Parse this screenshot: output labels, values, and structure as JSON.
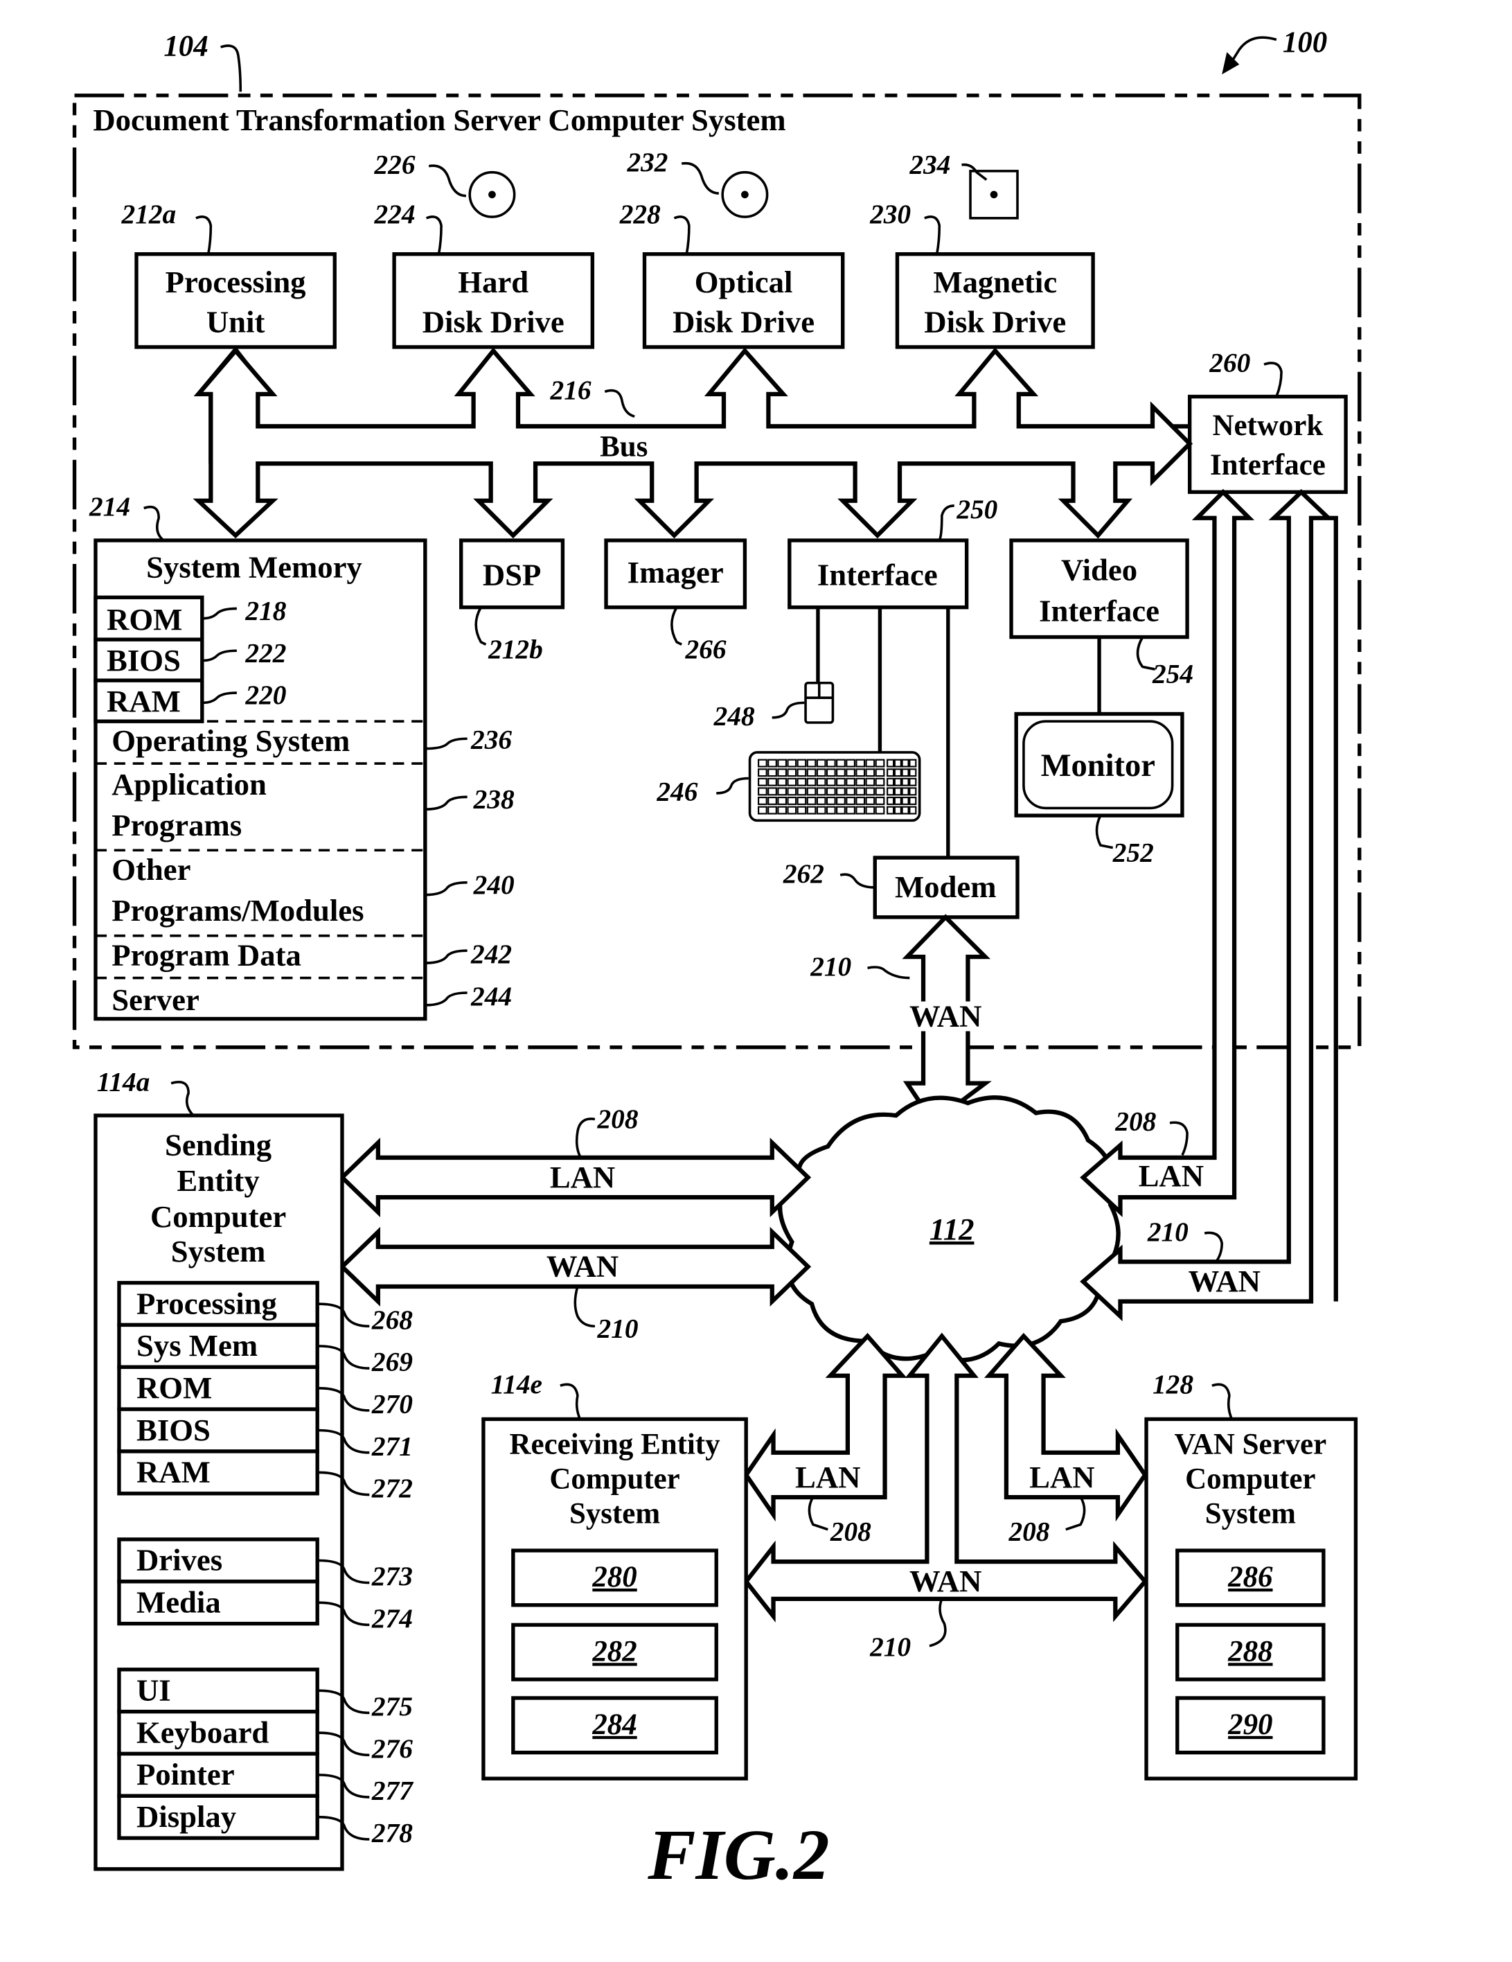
{
  "figure": {
    "title": "FIG.2",
    "ref_main": "100"
  },
  "server_system": {
    "ref": "104",
    "title": "Document Transformation Server Computer System",
    "bus": {
      "label": "Bus",
      "ref": "216"
    },
    "processing_unit": {
      "line1": "Processing",
      "line2": "Unit",
      "ref": "212a"
    },
    "hard_disk_drive": {
      "line1": "Hard",
      "line2": "Disk Drive",
      "ref": "224",
      "media_ref": "226"
    },
    "optical_disk_drive": {
      "line1": "Optical",
      "line2": "Disk Drive",
      "ref": "228",
      "media_ref": "232"
    },
    "magnetic_disk_drive": {
      "line1": "Magnetic",
      "line2": "Disk Drive",
      "ref": "230",
      "media_ref": "234"
    },
    "network_interface": {
      "line1": "Network",
      "line2": "Interface",
      "ref": "260"
    },
    "dsp": {
      "label": "DSP",
      "ref": "212b"
    },
    "imager": {
      "label": "Imager",
      "ref": "266"
    },
    "interface": {
      "label": "Interface",
      "ref": "250"
    },
    "video_interface": {
      "line1": "Video",
      "line2": "Interface",
      "ref": "254"
    },
    "monitor": {
      "label": "Monitor",
      "ref": "252"
    },
    "mouse": {
      "ref": "248"
    },
    "keyboard": {
      "ref": "246"
    },
    "modem": {
      "label": "Modem",
      "ref": "262"
    },
    "modem_wan": {
      "label": "WAN",
      "ref": "210"
    },
    "system_memory": {
      "title": "System Memory",
      "ref": "214",
      "rom": {
        "label": "ROM",
        "ref": "218"
      },
      "bios": {
        "label": "BIOS",
        "ref": "222"
      },
      "ram": {
        "label": "RAM",
        "ref": "220"
      },
      "sections": [
        {
          "line1": "Operating System",
          "line2": "",
          "ref": "236"
        },
        {
          "line1": "Application",
          "line2": "Programs",
          "ref": "238"
        },
        {
          "line1": "Other",
          "line2": "Programs/Modules",
          "ref": "240"
        },
        {
          "line1": "Program Data",
          "line2": "",
          "ref": "242"
        },
        {
          "line1": "Server",
          "line2": "",
          "ref": "244"
        }
      ]
    }
  },
  "network": {
    "ref": "112"
  },
  "links": {
    "left_lan": {
      "label": "LAN",
      "ref": "208"
    },
    "left_wan": {
      "label": "WAN",
      "ref": "210"
    },
    "right_lan": {
      "label": "LAN",
      "ref": "208"
    },
    "right_wan": {
      "label": "WAN",
      "ref": "210"
    },
    "recv_lan": {
      "label": "LAN",
      "ref": "208"
    },
    "van_lan": {
      "label": "LAN",
      "ref": "208"
    },
    "bottom_wan": {
      "label": "WAN",
      "ref": "210"
    }
  },
  "sending_entity": {
    "ref": "114a",
    "title": [
      "Sending",
      "Entity",
      "Computer",
      "System"
    ],
    "group1": [
      {
        "label": "Processing",
        "ref": "268"
      },
      {
        "label": "Sys Mem",
        "ref": "269"
      },
      {
        "label": "ROM",
        "ref": "270"
      },
      {
        "label": "BIOS",
        "ref": "271"
      },
      {
        "label": "RAM",
        "ref": "272"
      }
    ],
    "group2": [
      {
        "label": "Drives",
        "ref": "273"
      },
      {
        "label": "Media",
        "ref": "274"
      }
    ],
    "group3": [
      {
        "label": "UI",
        "ref": "275"
      },
      {
        "label": "Keyboard",
        "ref": "276"
      },
      {
        "label": "Pointer",
        "ref": "277"
      },
      {
        "label": "Display",
        "ref": "278"
      }
    ]
  },
  "receiving_entity": {
    "ref": "114e",
    "title": [
      "Receiving Entity",
      "Computer",
      "System"
    ],
    "items": [
      "280",
      "282",
      "284"
    ]
  },
  "van_server": {
    "ref": "128",
    "title": [
      "VAN Server",
      "Computer",
      "System"
    ],
    "items": [
      "286",
      "288",
      "290"
    ]
  }
}
